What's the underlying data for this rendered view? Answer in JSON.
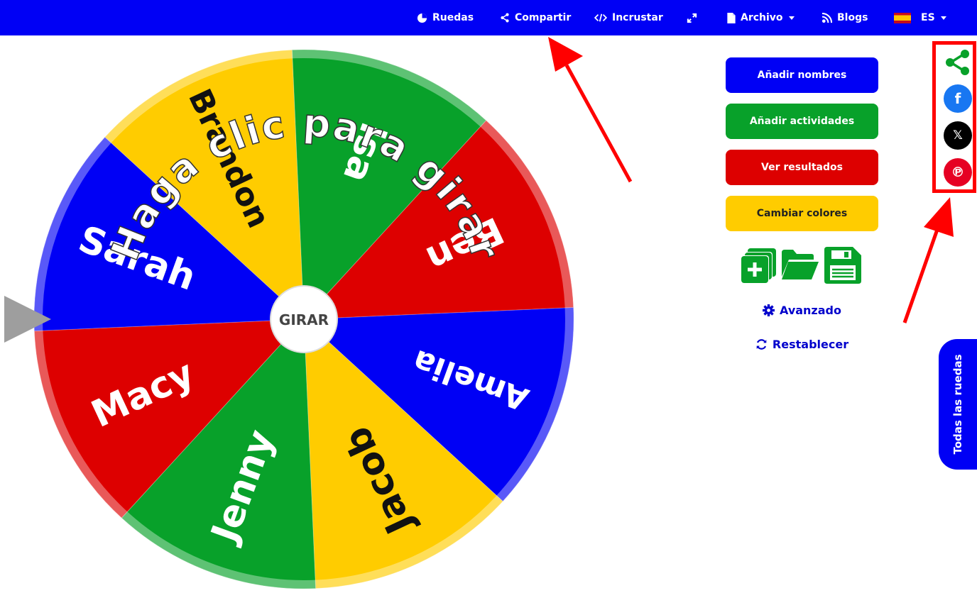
{
  "nav": {
    "ruedas": "Ruedas",
    "compartir": "Compartir",
    "incrustar": "Incrustar",
    "archivo": "Archivo",
    "blogs": "Blogs",
    "language": "ES"
  },
  "wheel": {
    "center_label": "GIRAR",
    "overlay_text": "Haga clic para girar",
    "segments": [
      {
        "name": "Amelia",
        "color": "#0000f5"
      },
      {
        "name": "Jacob",
        "color": "#ffcc00"
      },
      {
        "name": "Jenny",
        "color": "#08a12a"
      },
      {
        "name": "Macy",
        "color": "#dd0000"
      },
      {
        "name": "Sarah",
        "color": "#0000f5"
      },
      {
        "name": "Brandon",
        "color": "#ffcc00"
      },
      {
        "name": "Isa",
        "color": "#08a12a"
      },
      {
        "name": "Ben",
        "color": "#dd0000"
      }
    ]
  },
  "sidebar": {
    "add_names": "Añadir nombres",
    "add_activities": "Añadir actividades",
    "view_results": "Ver resultados",
    "change_colors": "Cambiar colores",
    "advanced": "Avanzado",
    "reset": "Restablecer"
  },
  "colors": {
    "nav_bg": "#0000f5",
    "blue": "#0000f5",
    "green": "#08a12a",
    "red": "#dd0000",
    "yellow": "#ffcc00",
    "annotation": "#ff0000"
  },
  "tab": {
    "all_wheels": "Todas las ruedas"
  }
}
